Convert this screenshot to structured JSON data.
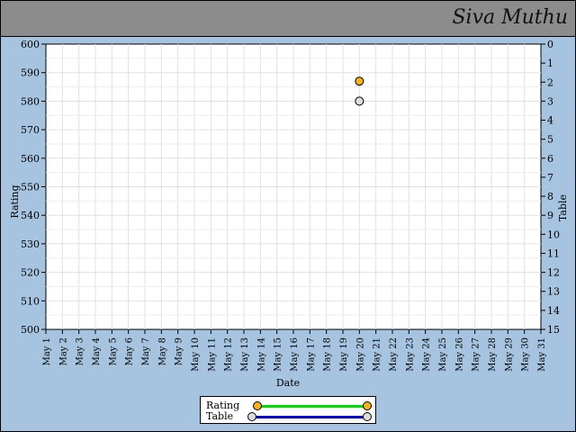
{
  "header": {
    "title": "Siva Muthu"
  },
  "colors": {
    "background": "#a6c4df",
    "header": "#8c8c8c",
    "rating": "#f5b21a",
    "rating_line": "#00dd00",
    "table": "#dcdcdc",
    "table_line": "#0000cc"
  },
  "chart_data": {
    "type": "scatter",
    "xlabel": "Date",
    "ylabel": "Rating",
    "y2label": "Table",
    "x": [
      "May 1",
      "May 2",
      "May 3",
      "May 4",
      "May 5",
      "May 6",
      "May 7",
      "May 8",
      "May 9",
      "May 10",
      "May 11",
      "May 12",
      "May 13",
      "May 14",
      "May 15",
      "May 16",
      "May 17",
      "May 18",
      "May 19",
      "May 20",
      "May 21",
      "May 22",
      "May 23",
      "May 24",
      "May 25",
      "May 26",
      "May 27",
      "May 28",
      "May 29",
      "May 30",
      "May 31"
    ],
    "ylim": [
      500,
      600
    ],
    "yticks": [
      600,
      590,
      580,
      570,
      560,
      550,
      540,
      530,
      520,
      510,
      500
    ],
    "y2lim": [
      0,
      15
    ],
    "y2ticks": [
      0,
      1,
      2,
      3,
      4,
      5,
      6,
      7,
      8,
      9,
      10,
      11,
      12,
      13,
      14,
      15
    ],
    "y2_inverted": true,
    "grid": true,
    "legend_position": "bottom-center",
    "series": [
      {
        "name": "Rating",
        "axis": "left",
        "points": [
          {
            "x": "May 20",
            "y": 587
          }
        ]
      },
      {
        "name": "Table",
        "axis": "right",
        "points": [
          {
            "x": "May 20",
            "y": 3
          }
        ]
      }
    ]
  },
  "legend": [
    {
      "name": "Rating"
    },
    {
      "name": "Table"
    }
  ]
}
